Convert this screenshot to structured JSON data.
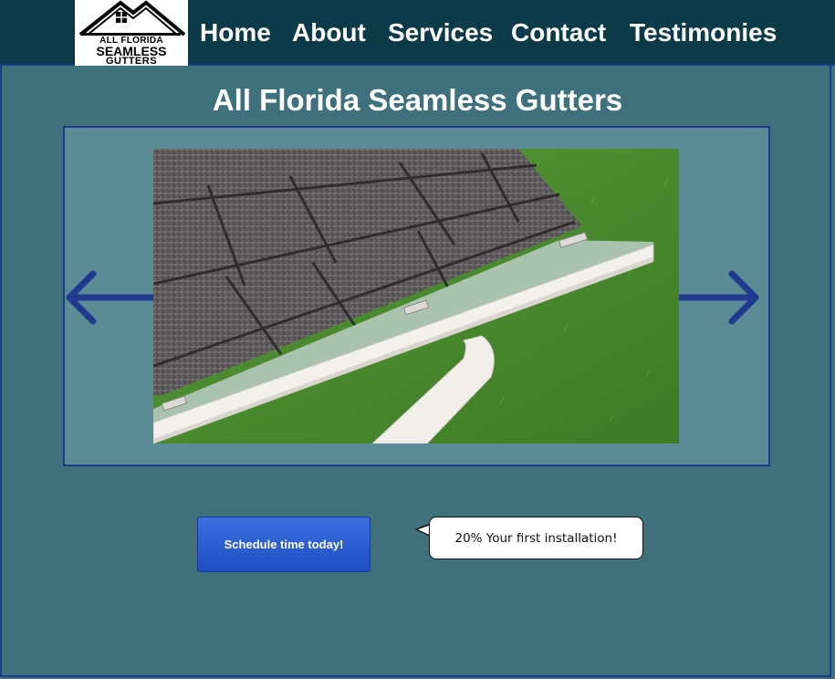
{
  "logo": {
    "line1": "ALL FLORIDA",
    "line2": "SEAMLESS",
    "line3": "GUTTERS"
  },
  "nav": {
    "items": [
      {
        "label": "Home"
      },
      {
        "label": "About"
      },
      {
        "label": "Services"
      },
      {
        "label": "Contact"
      },
      {
        "label": "Testimonies"
      }
    ]
  },
  "hero": {
    "title": "All Florida Seamless Gutters"
  },
  "carousel": {
    "prev_icon": "arrow-left-icon",
    "next_icon": "arrow-right-icon",
    "slide_alt": "Roof shingles with white gutter"
  },
  "cta": {
    "button_label": "Schedule time today!",
    "promo_text": "20% Your first installation!"
  },
  "colors": {
    "page_bg": "#3f717c",
    "navbar_bg": "#0c3a49",
    "border": "#1e3c8a",
    "carousel_bg": "#5b8b94",
    "button": "#2a5bd7"
  }
}
